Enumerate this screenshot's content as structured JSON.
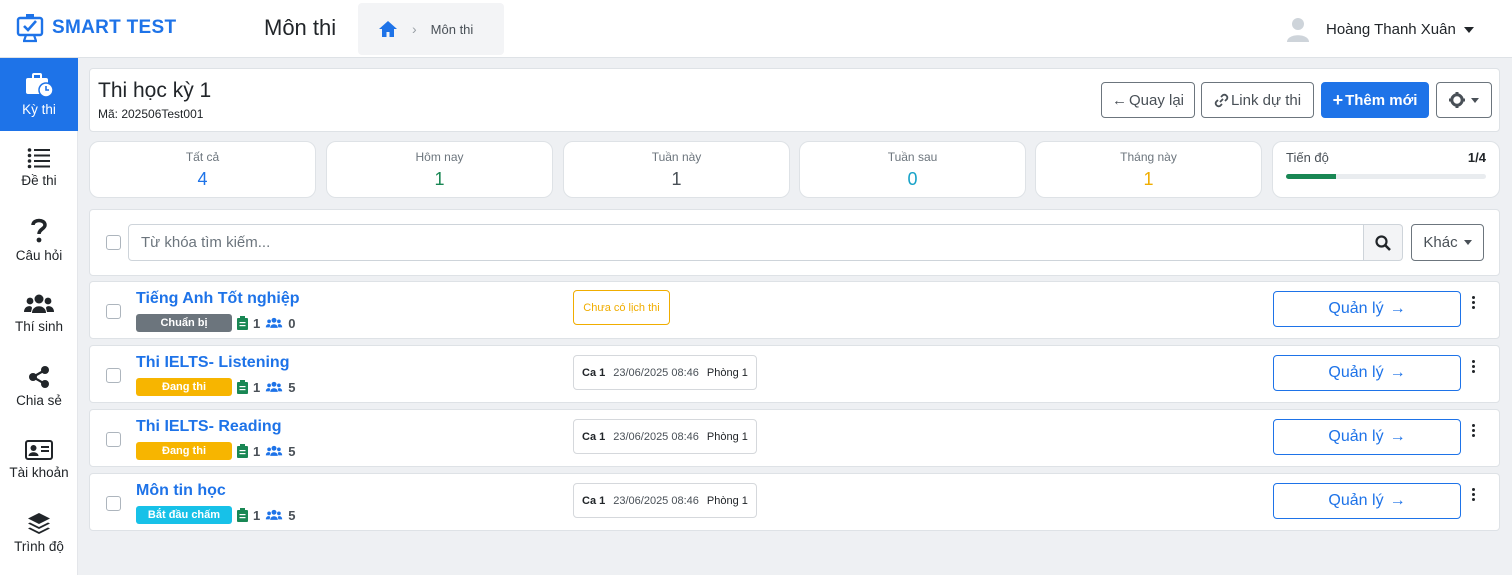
{
  "app": {
    "name": "SMART TEST"
  },
  "header": {
    "page_title": "Môn thi",
    "breadcrumb": {
      "current": "Môn thi"
    },
    "user": {
      "name": "Hoàng Thanh Xuân"
    }
  },
  "sidebar": {
    "items": [
      {
        "label": "Kỳ thi",
        "icon": "briefcase-clock-icon",
        "active": true
      },
      {
        "label": "Đề thi",
        "icon": "list-icon",
        "active": false
      },
      {
        "label": "Câu hỏi",
        "icon": "question-icon",
        "active": false
      },
      {
        "label": "Thí sinh",
        "icon": "users-icon",
        "active": false
      },
      {
        "label": "Chia sẻ",
        "icon": "share-icon",
        "active": false
      },
      {
        "label": "Tài khoản",
        "icon": "id-card-icon",
        "active": false
      },
      {
        "label": "Trình độ",
        "icon": "layers-icon",
        "active": false
      }
    ]
  },
  "exam": {
    "title": "Thi học kỳ 1",
    "code": "Mã: 202506Test001",
    "actions": {
      "back": "Quay lại",
      "link": "Link dự thi",
      "add": "Thêm mới"
    }
  },
  "stats": [
    {
      "label": "Tất cả",
      "value": "4",
      "color": "#1e73e8"
    },
    {
      "label": "Hôm nay",
      "value": "1",
      "color": "#198754"
    },
    {
      "label": "Tuần này",
      "value": "1",
      "color": "#495057"
    },
    {
      "label": "Tuần sau",
      "value": "0",
      "color": "#17a2c8"
    },
    {
      "label": "Tháng này",
      "value": "1",
      "color": "#f0ad00"
    }
  ],
  "progress": {
    "label": "Tiến độ",
    "count": "1/4",
    "fraction": 0.25
  },
  "search": {
    "placeholder": "Từ khóa tìm kiếm...",
    "more_label": "Khác"
  },
  "subjects": [
    {
      "name": "Tiếng Anh Tốt nghiệp",
      "status": "Chuẩn bị",
      "status_color": "#6c757d",
      "papers": "1",
      "candidates": "0",
      "no_schedule": "Chưa có lịch thi",
      "manage": "Quản lý"
    },
    {
      "name": "Thi IELTS- Listening",
      "status": "Đang thi",
      "status_color": "#f7b500",
      "papers": "1",
      "candidates": "5",
      "shift": "Ca 1",
      "datetime": "23/06/2025 08:46",
      "room": "Phòng 1",
      "manage": "Quản lý"
    },
    {
      "name": "Thi IELTS- Reading",
      "status": "Đang thi",
      "status_color": "#f7b500",
      "papers": "1",
      "candidates": "5",
      "shift": "Ca 1",
      "datetime": "23/06/2025 08:46",
      "room": "Phòng 1",
      "manage": "Quản lý"
    },
    {
      "name": "Môn tin học",
      "status": "Bắt đầu chấm",
      "status_color": "#17c1e8",
      "papers": "1",
      "candidates": "5",
      "shift": "Ca 1",
      "datetime": "23/06/2025 08:46",
      "room": "Phòng 1",
      "manage": "Quản lý"
    }
  ],
  "colors": {
    "primary": "#1e73e8",
    "success": "#198754",
    "warning": "#f0ad00"
  }
}
